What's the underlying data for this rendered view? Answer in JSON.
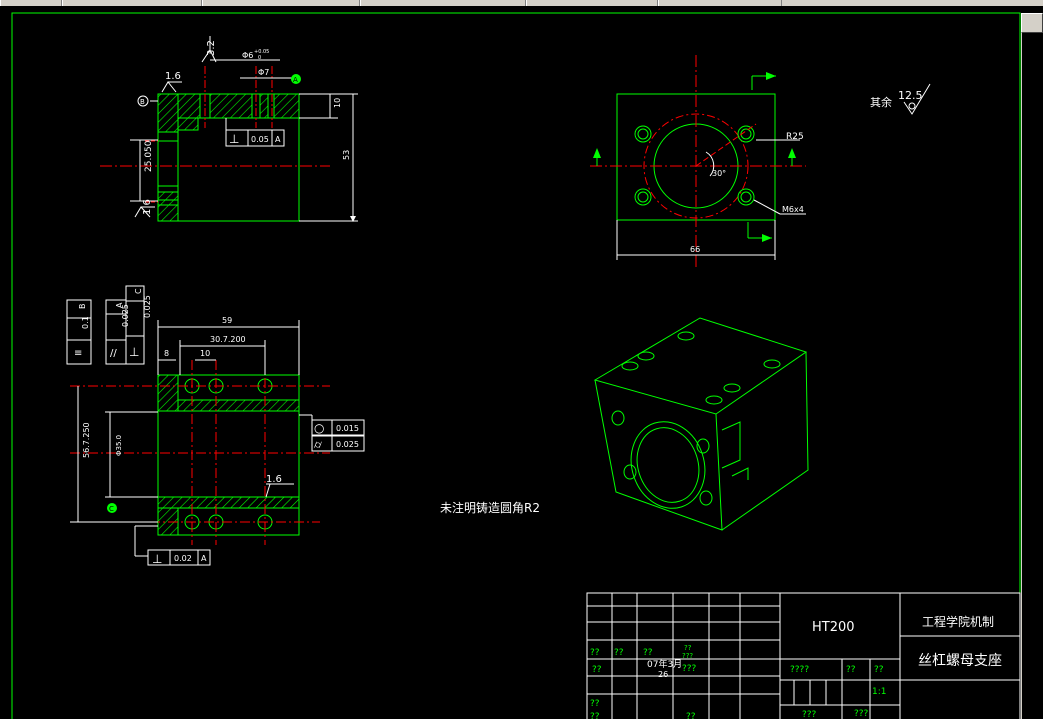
{
  "colors": {
    "background": "#000000",
    "outline": "#00ff00",
    "centerline": "#ff0000",
    "dimension": "#ffffff",
    "hatch": "#00ff00",
    "toolbar": "#d4d0c8"
  },
  "view_top": {
    "roughness_left": "1.6",
    "roughness_top": "3.2",
    "hole_dim": "Φ6",
    "hole_tol_upper": "+0.05",
    "hole_tol_lower": "0",
    "dim_phi7": "Φ7",
    "datum_a": "A",
    "datum_b": "B",
    "dim_10": "10",
    "dim_53": "53",
    "dim_25": "25.050",
    "roughness_bottom": "1.6",
    "fcf_symbol": "⊥",
    "fcf_value": "0.05",
    "fcf_datum": "A"
  },
  "view_side": {
    "fcf1": {
      "symbol": "≡",
      "value": "0.1",
      "datum": "B"
    },
    "fcf2": {
      "symbol": "//",
      "value": "0.025",
      "datum": "A"
    },
    "fcf3": {
      "symbol": "⊥",
      "value": "0.025",
      "datum": "C"
    },
    "dim_59": "59",
    "dim_30": "30.7.200",
    "dim_10": "10",
    "dim_8": "8",
    "dim_56": "56.7.250",
    "dim_phi": "Φ35.0",
    "circ_symbol": "○",
    "circ_value": "0.015",
    "cyl_symbol": "⌭",
    "cyl_value": "0.025",
    "roughness": "1.6",
    "fcf_bottom": {
      "symbol": "⊥",
      "value": "0.02",
      "datum": "A"
    },
    "datum_c": "C"
  },
  "view_front": {
    "r25": "R25",
    "angle": "30°",
    "thread": "M6x4",
    "dim_66": "66"
  },
  "note_other": "其余",
  "note_roughness": "12.5",
  "note_fillet": "未注明铸造圆角R2",
  "title_block": {
    "material": "HT200",
    "school": "工程学院机制",
    "part_name": "丝杠螺母支座",
    "scale": "1:1",
    "date": "07年3月",
    "day": "26",
    "placeholder_q2": "??",
    "placeholder_q3": "???",
    "placeholder_q4": "????"
  }
}
